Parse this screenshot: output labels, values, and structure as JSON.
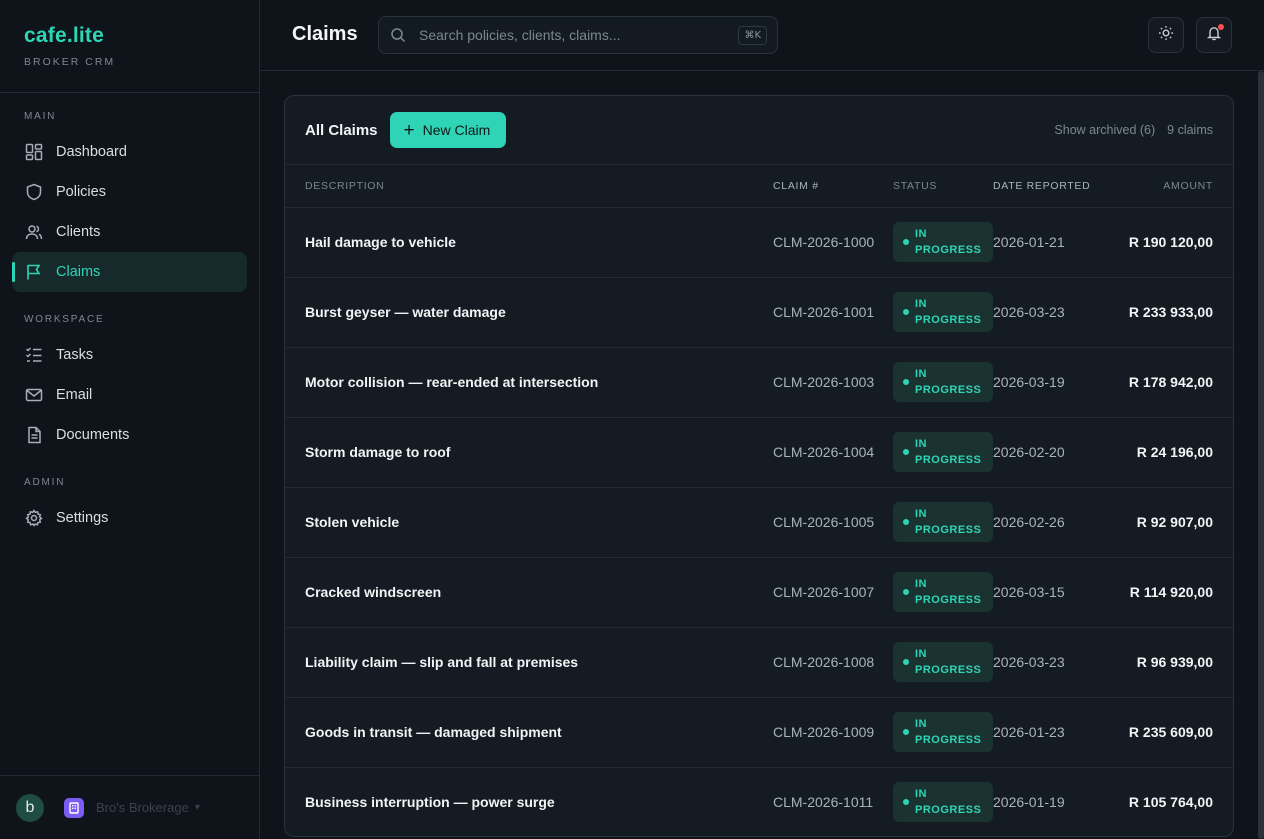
{
  "brand": {
    "name": "cafe.lite",
    "subtitle": "BROKER CRM"
  },
  "sidebar": {
    "sections": {
      "main": "MAIN",
      "workspace": "WORKSPACE",
      "admin": "ADMIN"
    },
    "items": {
      "dashboard": "Dashboard",
      "policies": "Policies",
      "clients": "Clients",
      "claims": "Claims",
      "tasks": "Tasks",
      "email": "Email",
      "documents": "Documents",
      "settings": "Settings"
    },
    "active": "Claims",
    "footer": {
      "avatar_letter": "b",
      "org_name": "Bro's Brokerage"
    }
  },
  "header": {
    "title": "Claims",
    "search_placeholder": "Search policies, clients, claims...",
    "shortcut": "⌘K",
    "notification_dot_color": "#ff4d4f"
  },
  "card": {
    "title": "All Claims",
    "new_button": "New Claim",
    "show_archived": "Show archived (6)",
    "count": "9 claims"
  },
  "table": {
    "columns": {
      "description": "DESCRIPTION",
      "claim": "CLAIM #",
      "status": "STATUS",
      "date": "DATE REPORTED",
      "amount": "AMOUNT"
    },
    "rows": [
      {
        "description": "Hail damage to vehicle",
        "claim": "CLM-2026-1000",
        "status_line1": "IN",
        "status_line2": "PROGRESS",
        "date": "2026-01-21",
        "amount": "R 190 120,00"
      },
      {
        "description": "Burst geyser — water damage",
        "claim": "CLM-2026-1001",
        "status_line1": "IN",
        "status_line2": "PROGRESS",
        "date": "2026-03-23",
        "amount": "R 233 933,00"
      },
      {
        "description": "Motor collision — rear-ended at intersection",
        "claim": "CLM-2026-1003",
        "status_line1": "IN",
        "status_line2": "PROGRESS",
        "date": "2026-03-19",
        "amount": "R 178 942,00"
      },
      {
        "description": "Storm damage to roof",
        "claim": "CLM-2026-1004",
        "status_line1": "IN",
        "status_line2": "PROGRESS",
        "date": "2026-02-20",
        "amount": "R 24 196,00"
      },
      {
        "description": "Stolen vehicle",
        "claim": "CLM-2026-1005",
        "status_line1": "IN",
        "status_line2": "PROGRESS",
        "date": "2026-02-26",
        "amount": "R 92 907,00"
      },
      {
        "description": "Cracked windscreen",
        "claim": "CLM-2026-1007",
        "status_line1": "IN",
        "status_line2": "PROGRESS",
        "date": "2026-03-15",
        "amount": "R 114 920,00"
      },
      {
        "description": "Liability claim — slip and fall at premises",
        "claim": "CLM-2026-1008",
        "status_line1": "IN",
        "status_line2": "PROGRESS",
        "date": "2026-03-23",
        "amount": "R 96 939,00"
      },
      {
        "description": "Goods in transit — damaged shipment",
        "claim": "CLM-2026-1009",
        "status_line1": "IN",
        "status_line2": "PROGRESS",
        "date": "2026-01-23",
        "amount": "R 235 609,00"
      },
      {
        "description": "Business interruption — power surge",
        "claim": "CLM-2026-1011",
        "status_line1": "IN",
        "status_line2": "PROGRESS",
        "date": "2026-01-19",
        "amount": "R 105 764,00"
      }
    ]
  },
  "colors": {
    "accent": "#2fd4b6",
    "background": "#0f141b",
    "card": "#141b22"
  },
  "icons": [
    "search-icon",
    "sun-icon",
    "bell-icon",
    "grid-icon",
    "shield-icon",
    "users-icon",
    "flag-icon",
    "tasks-icon",
    "mail-icon",
    "document-icon",
    "gear-icon",
    "plus-icon",
    "building-icon",
    "chevron-down-icon"
  ]
}
